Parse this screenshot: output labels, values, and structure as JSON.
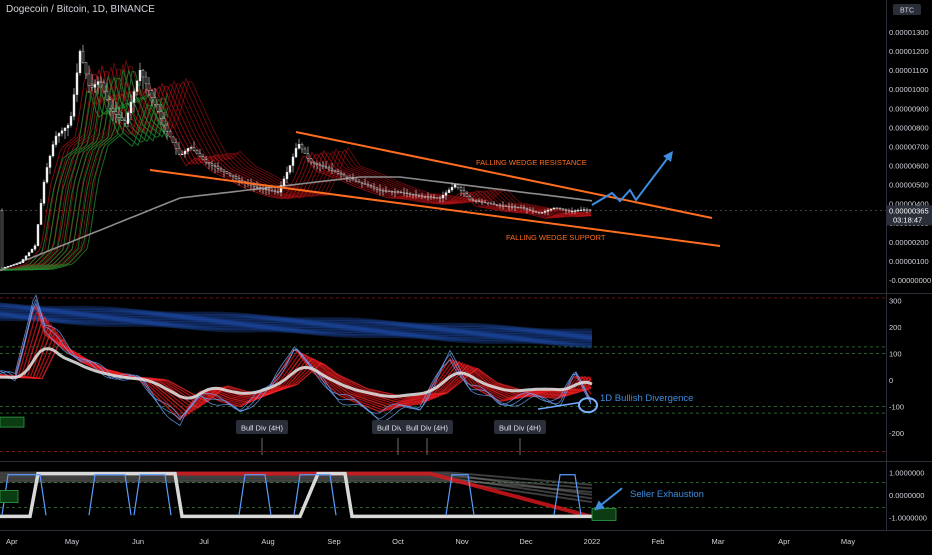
{
  "header": {
    "symbol_title": "Dogecoin / Bitcoin, 1D, BINANCE"
  },
  "price_scale": {
    "currency_badge": "BTC",
    "tick_labels": [
      "0.00001300",
      "0.00001200",
      "0.00001100",
      "0.00001000",
      "0.00000900",
      "0.00000800",
      "0.00000700",
      "0.00000600",
      "0.00000500",
      "0.00000400",
      "0.00000300",
      "0.00000200",
      "0.00000100",
      "-0.00000000"
    ],
    "current_price": "0.00000365",
    "countdown": "03:18:47"
  },
  "time_axis": {
    "labels": [
      "Apr",
      "May",
      "Jun",
      "Jul",
      "Aug",
      "Sep",
      "Oct",
      "Nov",
      "Dec",
      "2022",
      "Feb",
      "Mar",
      "Apr",
      "May"
    ]
  },
  "annotations": {
    "resistance_label": "FALLING WEDGE RESISTANCE",
    "support_label": "FALLING WEDGE SUPPORT",
    "bullish_divergence": "1D Bullish Divergence",
    "seller_exhaustion": "Seller Exhaustion",
    "bull_div_labels": [
      "Bull Div (4H)",
      "Bull Div (4H)",
      "Bull Div (4H)",
      "Bull Div (4H)"
    ]
  },
  "colors": {
    "background": "#000000",
    "wedge": "#ff6d1f",
    "projection": "#3d8de0",
    "red_ribbon": "#e0161b",
    "green_ribbon": "#1e8a2e",
    "blue_band": "#1f4fb5",
    "axis_text": "#d1d4dc",
    "price_badge": "#2a2e39"
  },
  "chart_data": [
    {
      "type": "line",
      "title": "Dogecoin / Bitcoin, 1D, BINANCE",
      "x": [
        "Apr",
        "May",
        "Jun",
        "Jul",
        "Aug",
        "Sep",
        "Oct",
        "Nov",
        "Dec",
        "2022"
      ],
      "ylim": [
        0,
        1.3e-05
      ],
      "series": [
        {
          "values": [
            5e-07,
            1.15e-05,
            9.8e-06,
            5.8e-06,
            5e-06,
            6.8e-06,
            5.1e-06,
            4.8e-06,
            4.2e-06,
            3.65e-06
          ]
        }
      ],
      "wedge": {
        "resistance": [
          [
            "Aug",
            7.4e-06
          ],
          [
            "Feb",
            4.5e-06
          ]
        ],
        "support": [
          [
            "May",
            4.6e-06
          ],
          [
            "Mar",
            1.7e-06
          ]
        ]
      }
    },
    {
      "type": "line",
      "ylim": [
        -250,
        300
      ],
      "tick_labels": [
        "300",
        "200",
        "100",
        "0",
        "-100",
        "-200"
      ]
    },
    {
      "type": "line",
      "ylim": [
        -1.2,
        1.3
      ],
      "tick_labels": [
        "1.0000000",
        "0.0000000",
        "-1.0000000"
      ]
    }
  ]
}
